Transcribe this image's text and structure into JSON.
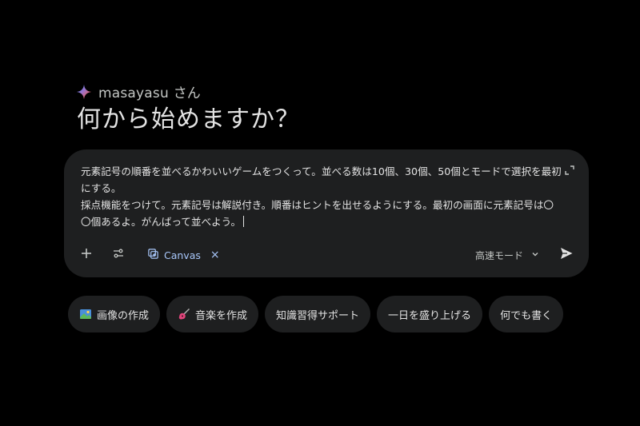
{
  "greeting": {
    "name": "masayasu さん",
    "headline": "何から始めますか？"
  },
  "composer": {
    "lines": [
      "元素記号の順番を並べるかわいいゲームをつくって。並べる数は10個、30個、50個とモードで選択を最初にする。",
      "採点機能をつけて。元素記号は解説付き。順番はヒントを出せるようにする。最初の画面に元素記号は〇〇個あるよ。がんばって並べよう。"
    ],
    "tool_chip_label": "Canvas",
    "tool_chip_close": "×",
    "mode_label": "高速モード",
    "icons": {
      "add": "plus-icon",
      "tools": "tune-icon",
      "canvas": "canvas-icon",
      "expand": "expand-icon",
      "mode_dropdown": "chevron-down-icon",
      "send": "send-icon"
    }
  },
  "suggestions": [
    {
      "label": "画像の作成",
      "icon": "image-icon"
    },
    {
      "label": "音楽を作成",
      "icon": "guitar-icon"
    },
    {
      "label": "知識習得サポート",
      "icon": ""
    },
    {
      "label": "一日を盛り上げる",
      "icon": ""
    },
    {
      "label": "何でも書く",
      "icon": ""
    }
  ],
  "colors": {
    "background": "#000000",
    "surface": "#1e1f20",
    "text": "#e3e3e3",
    "accent": "#a8c7fa"
  }
}
